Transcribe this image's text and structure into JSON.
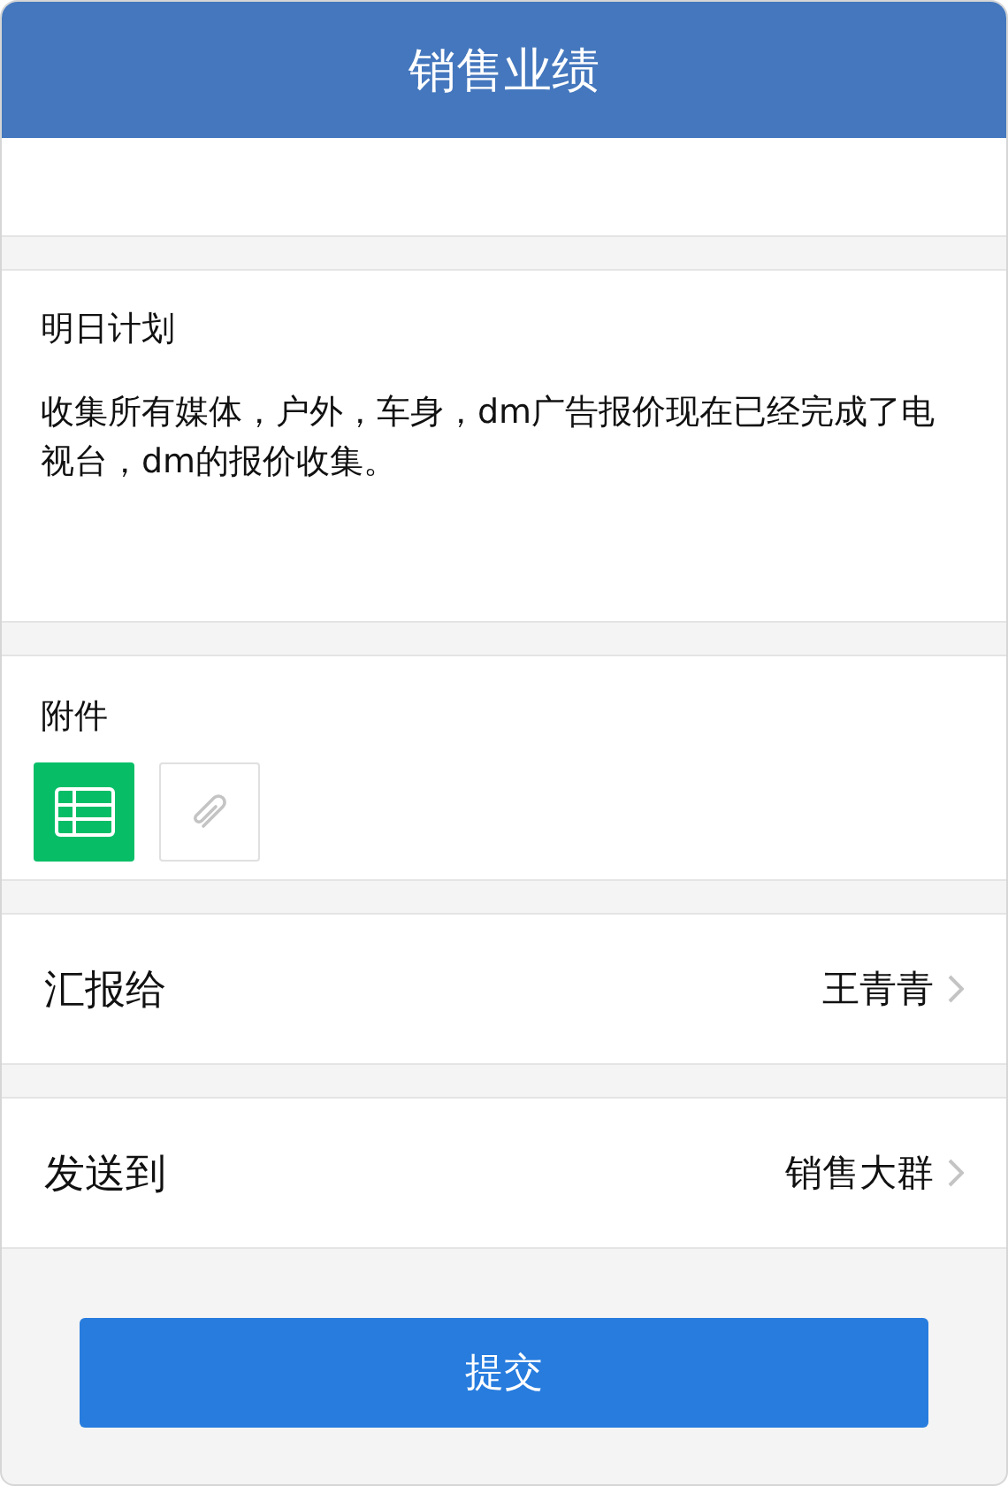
{
  "header": {
    "title": "销售业绩"
  },
  "plan": {
    "label": "明日计划",
    "text": "收集所有媒体，户外，车身，dm广告报价现在已经完成了电视台，dm的报价收集。"
  },
  "attachments": {
    "label": "附件",
    "items": [
      {
        "kind": "spreadsheet"
      },
      {
        "kind": "add"
      }
    ]
  },
  "rows": [
    {
      "label": "汇报给",
      "value": "王青青"
    },
    {
      "label": "发送到",
      "value": "销售大群"
    }
  ],
  "submit": {
    "label": "提交"
  }
}
